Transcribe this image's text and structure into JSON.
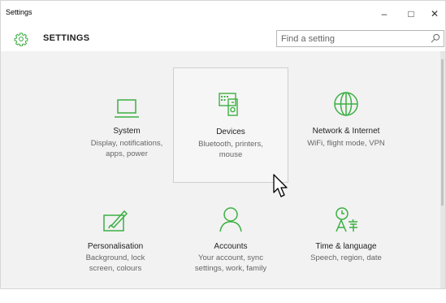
{
  "window": {
    "title": "Settings",
    "controls": {
      "minimize": "–",
      "maximize": "□",
      "close": "✕"
    }
  },
  "header": {
    "title": "SETTINGS",
    "icon": "gear-icon",
    "accent": "#3cb043"
  },
  "search": {
    "placeholder": "Find a setting",
    "value": ""
  },
  "tiles": [
    {
      "name": "System",
      "desc_lines": [
        "Display, notifications,",
        "apps, power"
      ],
      "icon": "laptop-icon"
    },
    {
      "name": "Devices",
      "desc_lines": [
        "Bluetooth, printers,",
        "mouse"
      ],
      "icon": "devices-icon"
    },
    {
      "name": "Network & Internet",
      "desc_lines": [
        "WiFi, flight mode, VPN"
      ],
      "icon": "globe-icon"
    },
    {
      "name": "Personalisation",
      "desc_lines": [
        "Background, lock",
        "screen, colours"
      ],
      "icon": "paintbrush-icon"
    },
    {
      "name": "Accounts",
      "desc_lines": [
        "Your account, sync",
        "settings, work, family"
      ],
      "icon": "person-icon"
    },
    {
      "name": "Time & language",
      "desc_lines": [
        "Speech, region, date"
      ],
      "icon": "time-language-icon"
    }
  ]
}
